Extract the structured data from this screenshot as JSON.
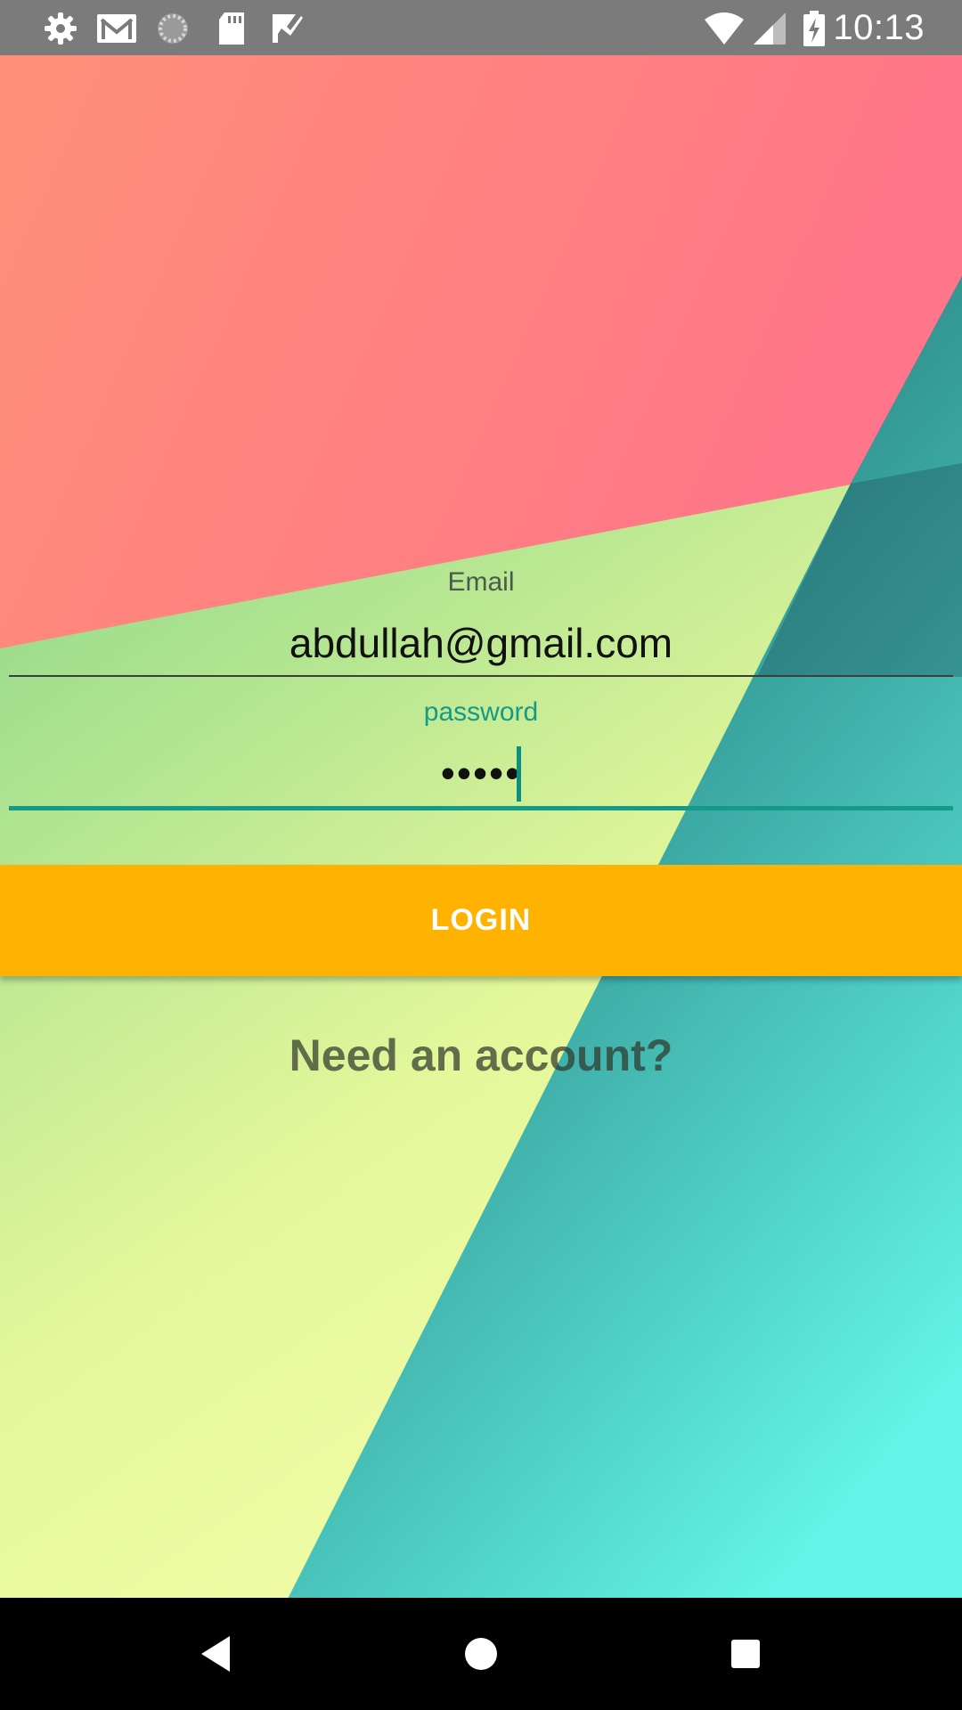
{
  "status_bar": {
    "left_icons": [
      "settings-icon",
      "gmail-icon",
      "sync-icon",
      "sd-card-icon",
      "task-icon"
    ],
    "right_icons": [
      "wifi-icon",
      "cell-signal-icon",
      "battery-charging-icon"
    ],
    "time": "10:13"
  },
  "login_form": {
    "email_label": "Email",
    "email_value": "abdullah@gmail.com",
    "password_label": "password",
    "password_value": "•••••",
    "login_button": "LOGIN",
    "need_account_link": "Need an account?"
  },
  "nav_bar": {
    "buttons": [
      "back-icon",
      "home-icon",
      "recents-icon"
    ]
  },
  "colors": {
    "status_bar": "#7b7b7b",
    "accent": "#139a88",
    "login_button": "#ffb200",
    "nav_bar": "#000000"
  }
}
